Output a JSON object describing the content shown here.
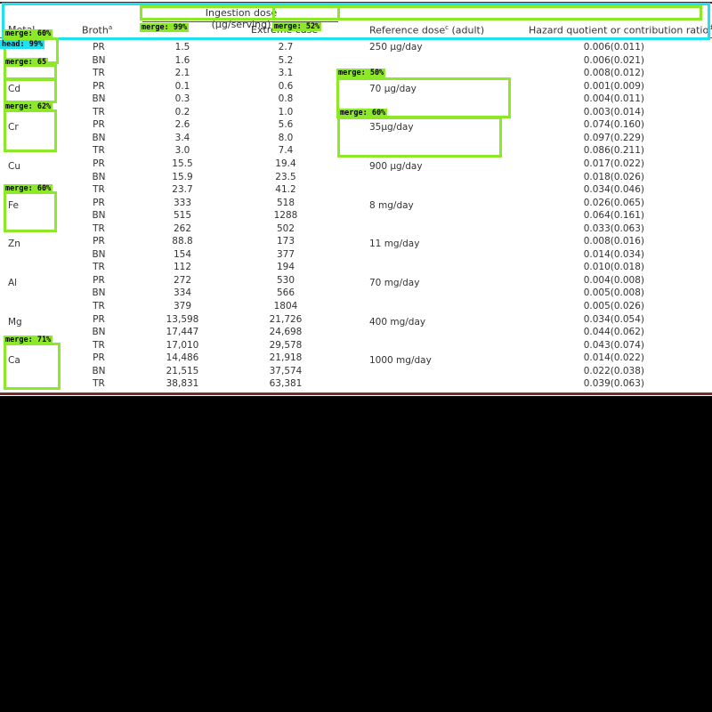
{
  "table": {
    "header_super": "Ingestion dose (μg/serving)",
    "headers": {
      "metal": "Metal",
      "broth": "Broth",
      "broth_sup": "a",
      "ingestion": "",
      "extreme": "Extreme case",
      "reference": "Reference dose",
      "reference_sup": "c",
      "reference_tail": " (adult)",
      "hazard": "Hazard quotient or contribution ratio",
      "hazard_sup": "d"
    },
    "metals": [
      {
        "name": "",
        "ref": "250 μg/day"
      },
      {
        "name": "Cd",
        "ref": "70 μg/day"
      },
      {
        "name": "Cr",
        "ref": "35μg/day"
      },
      {
        "name": "Cu",
        "ref": "900 μg/day"
      },
      {
        "name": "Fe",
        "ref": "8 mg/day"
      },
      {
        "name": "Zn",
        "ref": "11 mg/day"
      },
      {
        "name": "Al",
        "ref": "70 mg/day"
      },
      {
        "name": "Mg",
        "ref": "400 mg/day"
      },
      {
        "name": "Ca",
        "ref": "1000 mg/day"
      }
    ],
    "rows": [
      {
        "broth": "PR",
        "ing": "1.5",
        "ext": "2.7",
        "hq": "0.006(0.011)"
      },
      {
        "broth": "BN",
        "ing": "1.6",
        "ext": "5.2",
        "hq": "0.006(0.021)"
      },
      {
        "broth": "TR",
        "ing": "2.1",
        "ext": "3.1",
        "hq": "0.008(0.012)"
      },
      {
        "broth": "PR",
        "ing": "0.1",
        "ext": "0.6",
        "hq": "0.001(0.009)"
      },
      {
        "broth": "BN",
        "ing": "0.3",
        "ext": "0.8",
        "hq": "0.004(0.011)"
      },
      {
        "broth": "TR",
        "ing": "0.2",
        "ext": "1.0",
        "hq": "0.003(0.014)"
      },
      {
        "broth": "PR",
        "ing": "2.6",
        "ext": "5.6",
        "hq": "0.074(0.160)"
      },
      {
        "broth": "BN",
        "ing": "3.4",
        "ext": "8.0",
        "hq": "0.097(0.229)"
      },
      {
        "broth": "TR",
        "ing": "3.0",
        "ext": "7.4",
        "hq": "0.086(0.211)"
      },
      {
        "broth": "PR",
        "ing": "15.5",
        "ext": "19.4",
        "hq": "0.017(0.022)"
      },
      {
        "broth": "BN",
        "ing": "15.9",
        "ext": "23.5",
        "hq": "0.018(0.026)"
      },
      {
        "broth": "TR",
        "ing": "23.7",
        "ext": "41.2",
        "hq": "0.034(0.046)"
      },
      {
        "broth": "PR",
        "ing": "333",
        "ext": "518",
        "hq": "0.026(0.065)"
      },
      {
        "broth": "BN",
        "ing": "515",
        "ext": "1288",
        "hq": "0.064(0.161)"
      },
      {
        "broth": "TR",
        "ing": "262",
        "ext": "502",
        "hq": "0.033(0.063)"
      },
      {
        "broth": "PR",
        "ing": "88.8",
        "ext": "173",
        "hq": "0.008(0.016)"
      },
      {
        "broth": "BN",
        "ing": "154",
        "ext": "377",
        "hq": "0.014(0.034)"
      },
      {
        "broth": "TR",
        "ing": "112",
        "ext": "194",
        "hq": "0.010(0.018)"
      },
      {
        "broth": "PR",
        "ing": "272",
        "ext": "530",
        "hq": "0.004(0.008)"
      },
      {
        "broth": "BN",
        "ing": "334",
        "ext": "566",
        "hq": "0.005(0.008)"
      },
      {
        "broth": "TR",
        "ing": "379",
        "ext": "1804",
        "hq": "0.005(0.026)"
      },
      {
        "broth": "PR",
        "ing": "13,598",
        "ext": "21,726",
        "hq": "0.034(0.054)"
      },
      {
        "broth": "BN",
        "ing": "17,447",
        "ext": "24,698",
        "hq": "0.044(0.062)"
      },
      {
        "broth": "TR",
        "ing": "17,010",
        "ext": "29,578",
        "hq": "0.043(0.074)"
      },
      {
        "broth": "PR",
        "ing": "14,486",
        "ext": "21,918",
        "hq": "0.014(0.022)"
      },
      {
        "broth": "BN",
        "ing": "21,515",
        "ext": "37,574",
        "hq": "0.022(0.038)"
      },
      {
        "broth": "TR",
        "ing": "38,831",
        "ext": "63,381",
        "hq": "0.039(0.063)"
      }
    ]
  },
  "annotations": {
    "head": "head: 99%",
    "merge_60a": "merge: 60%",
    "merge_65": "merge: 65",
    "merge_62": "merge: 62%",
    "merge_60b": "merge: 60%",
    "merge_71": "merge: 71%",
    "merge_99": "merge: 99%",
    "merge_52": "merge: 52%",
    "merge_50": "merge: 50%",
    "merge_60c": "merge: 60%"
  },
  "colors": {
    "head_box": "#22e0f0",
    "merge_box": "#8ee82a",
    "bottom_rule": "#7a2a2a"
  }
}
